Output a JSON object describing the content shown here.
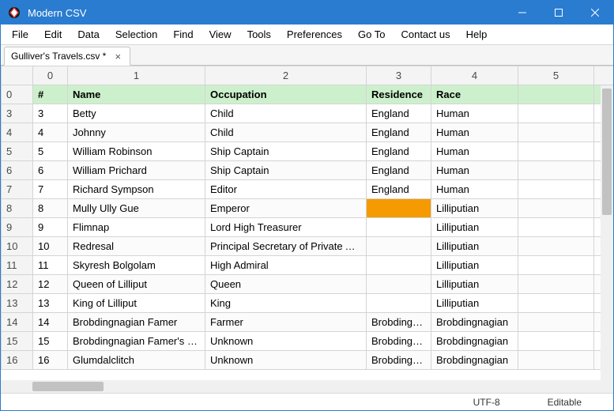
{
  "app": {
    "title": "Modern CSV"
  },
  "window_controls": {
    "minimize": "–",
    "maximize": "□",
    "close": "×"
  },
  "menu": {
    "items": [
      "File",
      "Edit",
      "Data",
      "Selection",
      "Find",
      "View",
      "Tools",
      "Preferences",
      "Go To",
      "Contact us",
      "Help"
    ]
  },
  "tabs": {
    "active": {
      "label": "Gulliver's Travels.csv *",
      "close": "×"
    }
  },
  "grid": {
    "column_index_headers": [
      "0",
      "1",
      "2",
      "3",
      "4",
      "5",
      ""
    ],
    "header_row": {
      "row_index": "0",
      "cells": [
        "#",
        "Name",
        "Occupation",
        "Residence",
        "Race",
        "",
        ""
      ]
    },
    "rows": [
      {
        "row_index": "3",
        "cells": [
          "3",
          "Betty",
          "Child",
          "England",
          "Human",
          "",
          ""
        ]
      },
      {
        "row_index": "4",
        "cells": [
          "4",
          "Johnny",
          "Child",
          "England",
          "Human",
          "",
          ""
        ]
      },
      {
        "row_index": "5",
        "cells": [
          "5",
          "William Robinson",
          "Ship Captain",
          "England",
          "Human",
          "",
          ""
        ]
      },
      {
        "row_index": "6",
        "cells": [
          "6",
          "William Prichard",
          "Ship Captain",
          "England",
          "Human",
          "",
          ""
        ]
      },
      {
        "row_index": "7",
        "cells": [
          "7",
          "Richard Sympson",
          "Editor",
          "England",
          "Human",
          "",
          ""
        ]
      },
      {
        "row_index": "8",
        "cells": [
          "8",
          "Mully Ully Gue",
          "Emperor",
          "",
          "Lilliputian",
          "",
          ""
        ],
        "highlight_col": 3
      },
      {
        "row_index": "9",
        "cells": [
          "9",
          "Flimnap",
          "Lord High Treasurer",
          "",
          "Lilliputian",
          "",
          ""
        ]
      },
      {
        "row_index": "10",
        "cells": [
          "10",
          "Redresal",
          "Principal Secretary of Private Affairs",
          "",
          "Lilliputian",
          "",
          ""
        ]
      },
      {
        "row_index": "11",
        "cells": [
          "11",
          "Skyresh Bolgolam",
          "High Admiral",
          "",
          "Lilliputian",
          "",
          ""
        ]
      },
      {
        "row_index": "12",
        "cells": [
          "12",
          "Queen of Lilliput",
          "Queen",
          "",
          "Lilliputian",
          "",
          ""
        ]
      },
      {
        "row_index": "13",
        "cells": [
          "13",
          "King of Lilliput",
          "King",
          "",
          "Lilliputian",
          "",
          ""
        ]
      },
      {
        "row_index": "14",
        "cells": [
          "14",
          "Brobdingnagian Famer",
          "Farmer",
          "Brobdingnag",
          "Brobdingnagian",
          "",
          ""
        ]
      },
      {
        "row_index": "15",
        "cells": [
          "15",
          "Brobdingnagian Famer's Wife",
          "Unknown",
          "Brobdingnag",
          "Brobdingnagian",
          "",
          ""
        ]
      },
      {
        "row_index": "16",
        "cells": [
          "16",
          "Glumdalclitch",
          "Unknown",
          "Brobdingnag",
          "Brobdingnagian",
          "",
          ""
        ]
      }
    ]
  },
  "statusbar": {
    "encoding": "UTF-8",
    "mode": "Editable"
  }
}
